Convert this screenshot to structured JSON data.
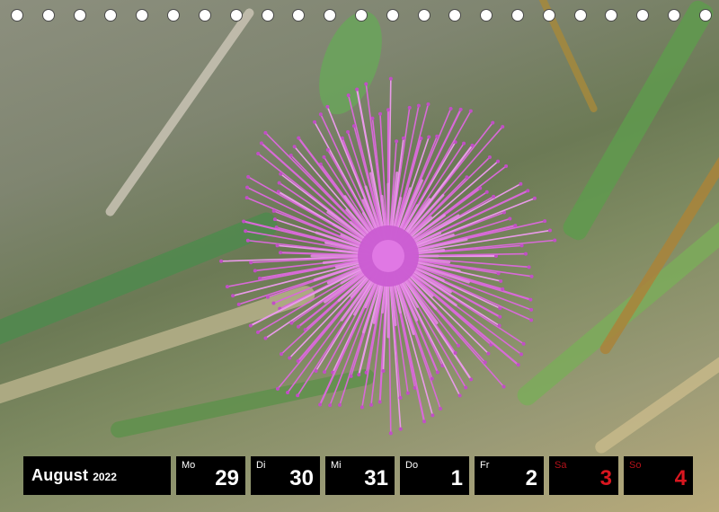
{
  "calendar": {
    "month": "August",
    "year": "2022",
    "days": [
      {
        "name": "Mo",
        "number": "29",
        "weekend": false
      },
      {
        "name": "Di",
        "number": "30",
        "weekend": false
      },
      {
        "name": "Mi",
        "number": "31",
        "weekend": false
      },
      {
        "name": "Do",
        "number": "1",
        "weekend": false
      },
      {
        "name": "Fr",
        "number": "2",
        "weekend": false
      },
      {
        "name": "Sa",
        "number": "3",
        "weekend": true
      },
      {
        "name": "So",
        "number": "4",
        "weekend": true
      }
    ]
  },
  "binding": {
    "hole_count": 23
  },
  "colors": {
    "flower": "#d86ad8",
    "flower_center": "#c14fc6",
    "weekend_text": "#d9161f",
    "strip_background": "#000000"
  }
}
